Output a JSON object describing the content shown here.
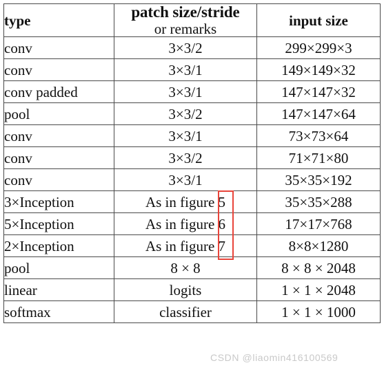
{
  "table": {
    "headers": {
      "type": "type",
      "patch_line1": "patch size/stride",
      "patch_line2": "or remarks",
      "input": "input size"
    },
    "rows": [
      {
        "type": "conv",
        "patch": "3×3/2",
        "input": "299×299×3"
      },
      {
        "type": "conv",
        "patch": "3×3/1",
        "input": "149×149×32"
      },
      {
        "type": "conv padded",
        "patch": "3×3/1",
        "input": "147×147×32"
      },
      {
        "type": "pool",
        "patch": "3×3/2",
        "input": "147×147×64"
      },
      {
        "type": "conv",
        "patch": "3×3/1",
        "input": "73×73×64"
      },
      {
        "type": "conv",
        "patch": "3×3/2",
        "input": "71×71×80"
      },
      {
        "type": "conv",
        "patch": "3×3/1",
        "input": "35×35×192"
      },
      {
        "type": "3×Inception",
        "patch": "As in figure 5",
        "input": "35×35×288"
      },
      {
        "type": "5×Inception",
        "patch": "As in figure 6",
        "input": "17×17×768"
      },
      {
        "type": "2×Inception",
        "patch": "As in figure 7",
        "input": "8×8×1280"
      },
      {
        "type": "pool",
        "patch": "8 × 8",
        "input": "8 × 8 × 2048"
      },
      {
        "type": "linear",
        "patch": "logits",
        "input": "1 × 1 × 2048"
      },
      {
        "type": "softmax",
        "patch": "classifier",
        "input": "1 × 1 × 1000"
      }
    ]
  },
  "annotation": {
    "name": "figure-number-highlight",
    "color": "#e8443a",
    "covers": [
      "5",
      "6",
      "7"
    ]
  },
  "watermark": {
    "text": "CSDN @liaomin416100569",
    "color": "#c9c9c9"
  }
}
